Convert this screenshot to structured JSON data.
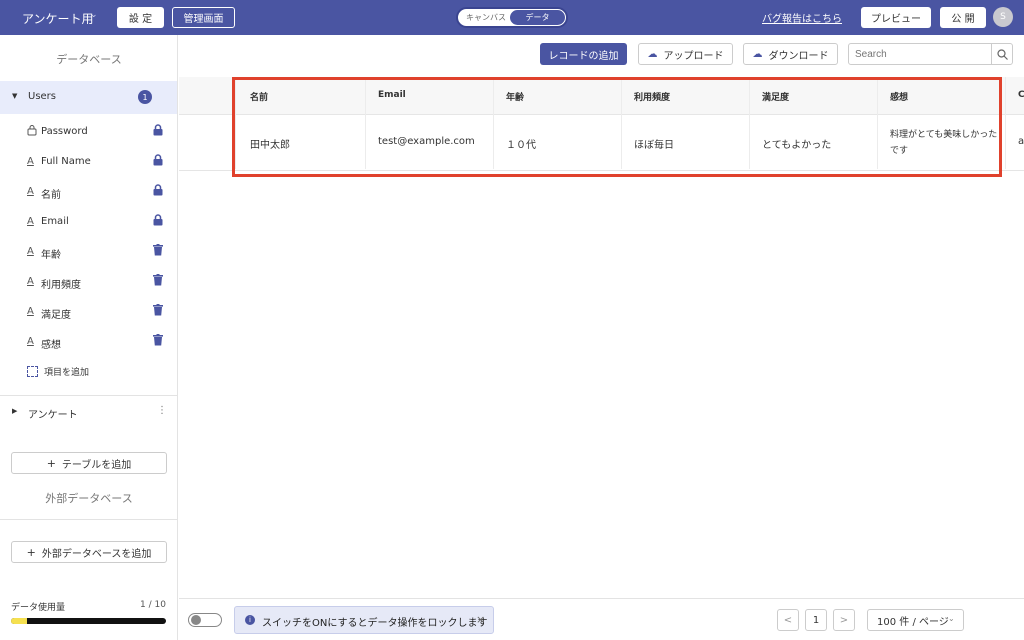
{
  "header": {
    "app_title": "アンケート用",
    "settings_label": "設 定",
    "admin_label": "管理画面",
    "view_toggle": {
      "canvas": "キャンバス",
      "data": "データ",
      "active": "data"
    },
    "bug_report_link": "バグ報告はこちら",
    "preview_label": "プレビュー",
    "publish_label": "公 開",
    "avatar_initial": "S"
  },
  "sidebar": {
    "database_heading": "データベース",
    "table": {
      "name": "Users",
      "count": "1"
    },
    "fields": [
      {
        "type_icon": "A",
        "label": "Password",
        "action_icon": "lock-icon"
      },
      {
        "type_icon": "A",
        "label": "Full Name",
        "action_icon": "lock-icon"
      },
      {
        "type_icon": "A",
        "label": "名前",
        "action_icon": "lock-icon"
      },
      {
        "type_icon": "A",
        "label": "Email",
        "action_icon": "lock-icon"
      },
      {
        "type_icon": "A",
        "label": "年齢",
        "action_icon": "trash-icon"
      },
      {
        "type_icon": "A",
        "label": "利用頻度",
        "action_icon": "trash-icon"
      },
      {
        "type_icon": "A",
        "label": "満足度",
        "action_icon": "trash-icon"
      },
      {
        "type_icon": "A",
        "label": "感想",
        "action_icon": "trash-icon"
      }
    ],
    "add_field_label": "項目を追加",
    "survey_group_label": "アンケート",
    "add_table_label": "テーブルを追加",
    "external_db_heading": "外部データベース",
    "add_external_db_label": "外部データベースを追加",
    "usage": {
      "label": "データ使用量",
      "count": "1 / 10",
      "fraction": 0.1
    }
  },
  "toolbar": {
    "add_record_label": "レコードの追加",
    "upload_label": "アップロード",
    "download_label": "ダウンロード",
    "search_placeholder": "Search",
    "search_value": ""
  },
  "table": {
    "columns": [
      "名前",
      "Email",
      "年齢",
      "利用頻度",
      "満足度",
      "感想",
      "C"
    ],
    "rows": [
      [
        "田中太郎",
        "test@example.com",
        "１０代",
        "ほぼ毎日",
        "とてもよかった",
        "料理がとても美味しかったです",
        "a"
      ]
    ]
  },
  "footer": {
    "lock_notice": "スイッチをONにするとデータ操作をロックします",
    "close_symbol": "×",
    "prev_symbol": "<",
    "next_symbol": ">",
    "current_page": "1",
    "page_size": "100 件 / ページ"
  },
  "colors": {
    "brand": "#4a55a2",
    "highlight": "#e0412c",
    "usage_fill": "#f5e050"
  }
}
